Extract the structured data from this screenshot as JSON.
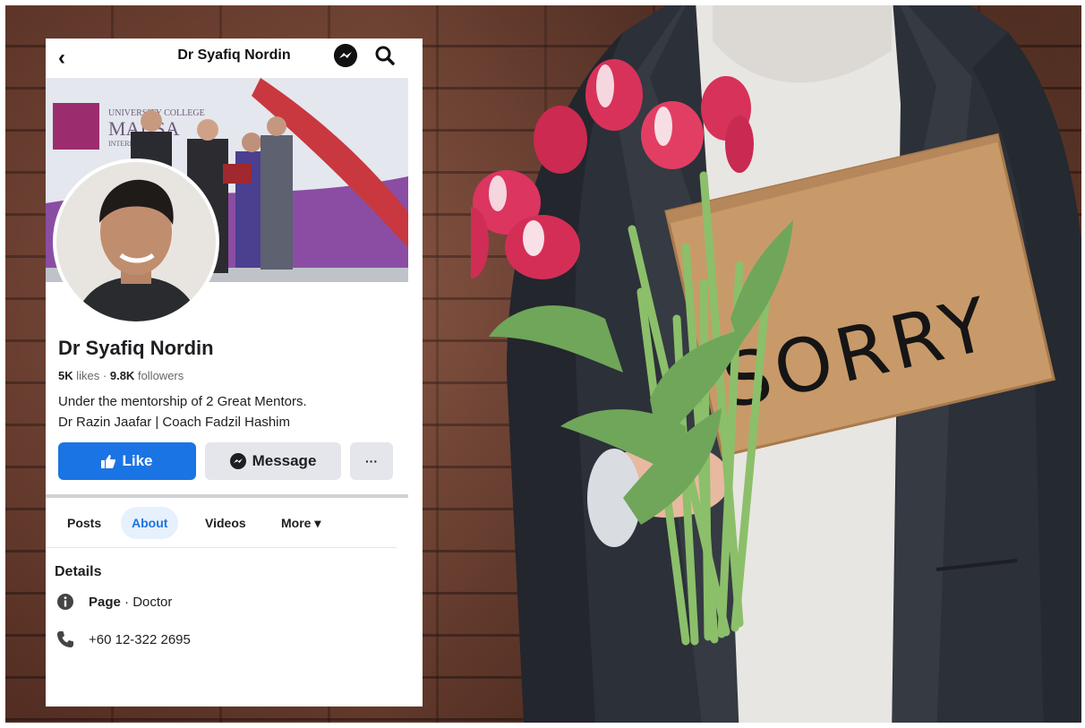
{
  "header": {
    "back_icon": "chevron-left-icon",
    "title": "Dr Syafiq Nordin"
  },
  "cover": {
    "banner_text_1": "UNIVERSITY COLLEGE",
    "banner_text_2": "MAHSA",
    "banner_text_3": "INTERNATIONAL"
  },
  "profile": {
    "name": "Dr Syafiq Nordin",
    "likes_count": "5K",
    "likes_label": "likes",
    "separator": "·",
    "followers_count": "9.8K",
    "followers_label": "followers",
    "bio_line1": "Under the mentorship of 2 Great Mentors.",
    "bio_line2": "Dr Razin Jaafar | Coach Fadzil Hashim"
  },
  "actions": {
    "like_label": "Like",
    "message_label": "Message",
    "more_label": "···"
  },
  "tabs": [
    {
      "label": "Posts"
    },
    {
      "label": "About"
    },
    {
      "label": "Videos"
    },
    {
      "label": "More ▾"
    }
  ],
  "details": {
    "heading": "Details",
    "page_label": "Page",
    "page_separator": " · ",
    "page_category": "Doctor",
    "phone": "+60 12-322 2695"
  },
  "sign": {
    "text": "SORRY"
  },
  "colors": {
    "facebook_blue": "#1b74e4",
    "tulip_pink": "#d8325a",
    "cardboard": "#c89a6a"
  }
}
